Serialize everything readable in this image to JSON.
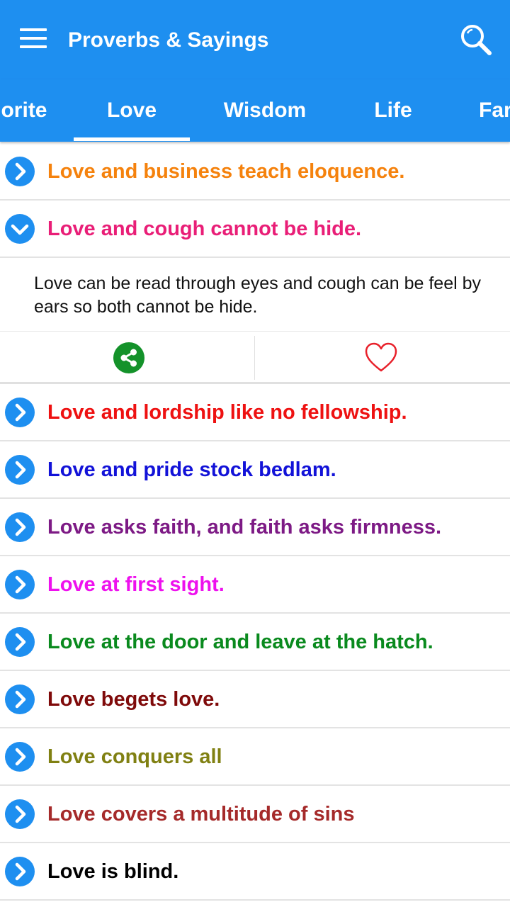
{
  "appbar": {
    "title": "Proverbs & Sayings",
    "menu_icon": "menu-icon",
    "search_icon": "search-icon",
    "color": "#1e8ff0"
  },
  "tabs": [
    {
      "label": "orite",
      "selected": false
    },
    {
      "label": "Love",
      "selected": true
    },
    {
      "label": "Wisdom",
      "selected": false
    },
    {
      "label": "Life",
      "selected": false
    },
    {
      "label": "Far",
      "selected": false
    }
  ],
  "proverbs": [
    {
      "text": "Love and business teach eloquence.",
      "color": "#f5820d",
      "expanded": false
    },
    {
      "text": "Love and cough cannot be hide.",
      "color": "#e91e77",
      "expanded": true
    },
    {
      "text": "Love and lordship like no fellowship.",
      "color": "#ee1111",
      "expanded": false
    },
    {
      "text": "Love and pride stock bedlam.",
      "color": "#1212d8",
      "expanded": false
    },
    {
      "text": "Love asks faith, and faith asks firmness.",
      "color": "#7d1a85",
      "expanded": false
    },
    {
      "text": "Love at first sight.",
      "color": "#ee11ee",
      "expanded": false
    },
    {
      "text": "Love at the door and leave at the hatch.",
      "color": "#0a8a1e",
      "expanded": false
    },
    {
      "text": "Love begets love.",
      "color": "#7f0a0a",
      "expanded": false
    },
    {
      "text": "Love conquers all",
      "color": "#808012",
      "expanded": false
    },
    {
      "text": "Love covers a multitude of sins",
      "color": "#a52a2a",
      "expanded": false
    },
    {
      "text": "Love is blind.",
      "color": "#000000",
      "expanded": false
    }
  ],
  "expanded_detail": {
    "meaning": "Love can be read through eyes and cough can be feel by ears so both cannot be hide.",
    "share_icon": "share-icon",
    "share_color": "#14922a",
    "favorite_icon": "heart-outline-icon",
    "favorite_color": "#e8202a"
  }
}
